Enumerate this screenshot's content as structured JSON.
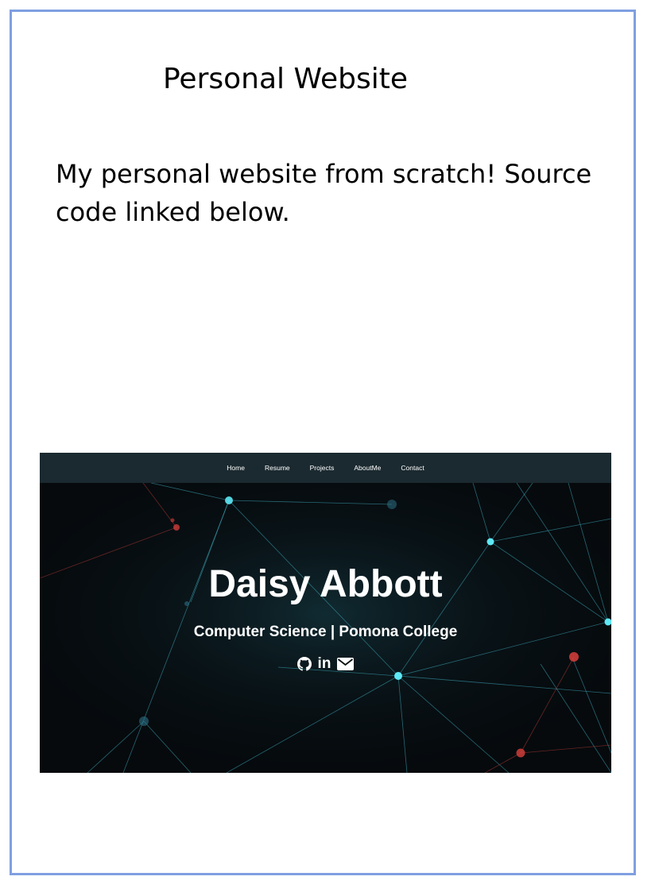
{
  "card": {
    "title": "Personal Website",
    "description": "My personal website from scratch! Source code linked below."
  },
  "screenshot": {
    "nav": [
      "Home",
      "Resume",
      "Projects",
      "AboutMe",
      "Contact"
    ],
    "name": "Daisy Abbott",
    "subtitle": "Computer Science | Pomona College",
    "social_icons": [
      "github-icon",
      "linkedin-icon",
      "envelope-icon"
    ],
    "linkedin_glyph": "in",
    "colors": {
      "frame_border": "#7f9fe0",
      "navbar_bg": "#1b2a30",
      "hero_bg": "#060a0d",
      "node_cyan": "#5ee8f5",
      "node_red": "#d9403c"
    }
  }
}
